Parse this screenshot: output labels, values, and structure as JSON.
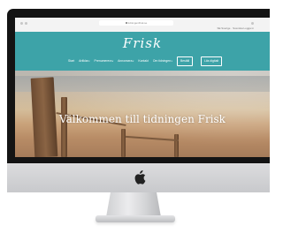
{
  "browser": {
    "url": "tidningenfrisk.se",
    "lang_bar": "SE  Sverige  ·  Svenska  Logga in"
  },
  "site": {
    "logo": "Frisk",
    "nav": [
      {
        "label": "Start",
        "has_dropdown": false
      },
      {
        "label": "Artiklar",
        "has_dropdown": true
      },
      {
        "label": "Prenumerera",
        "has_dropdown": true
      },
      {
        "label": "Annonsera",
        "has_dropdown": true
      },
      {
        "label": "Kontakt",
        "has_dropdown": false
      },
      {
        "label": "Om tidningen",
        "has_dropdown": true
      }
    ],
    "buttons": {
      "primary": "Beställ",
      "secondary": "Läs digitalt"
    },
    "hero_title": "Välkommen till tidningen Frisk"
  },
  "colors": {
    "header": "#3da3a8",
    "bezel": "#141414",
    "chin": "#d3d4d6"
  }
}
